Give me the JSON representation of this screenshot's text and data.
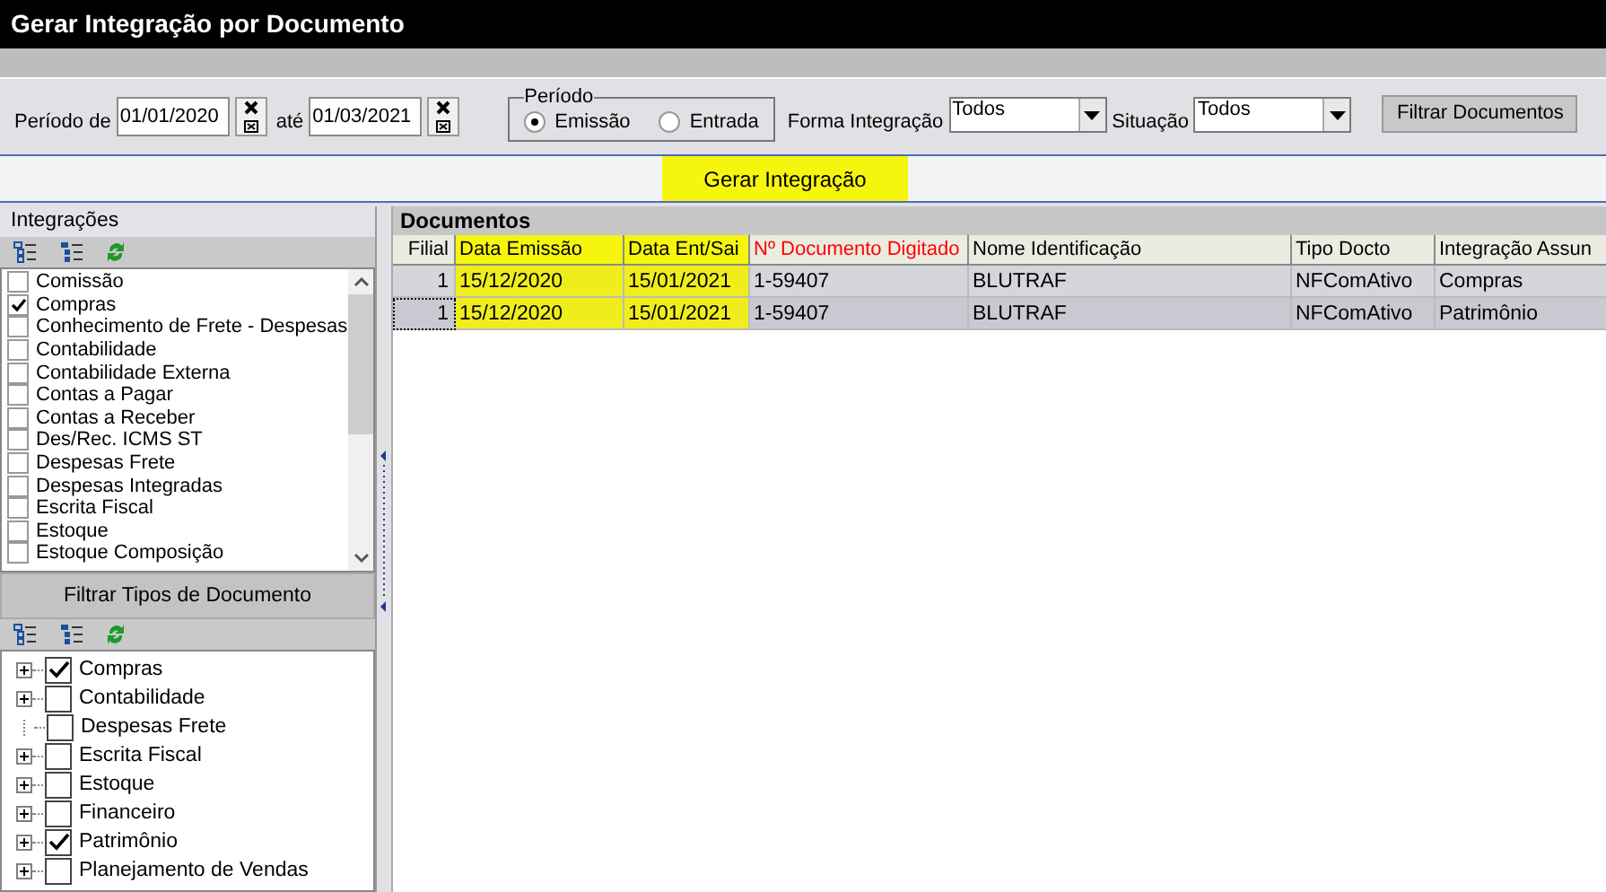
{
  "window": {
    "title": "Gerar Integração por Documento"
  },
  "filters": {
    "period_label": "Período de",
    "date_from": "01/01/2020",
    "until_label": "até",
    "date_to": "01/03/2021",
    "period_group": {
      "title": "Período",
      "options": [
        {
          "label": "Emissão",
          "selected": true
        },
        {
          "label": "Entrada",
          "selected": false
        }
      ]
    },
    "forma_label": "Forma Integração",
    "forma_value": "Todos",
    "situacao_label": "Situação",
    "situacao_value": "Todos",
    "filter_button": "Filtrar Documentos"
  },
  "generate_button": "Gerar Integração",
  "integrations": {
    "title": "Integrações",
    "items": [
      {
        "label": "Comissão",
        "checked": false
      },
      {
        "label": "Compras",
        "checked": true
      },
      {
        "label": "Conhecimento de Frete - Despesas",
        "checked": false
      },
      {
        "label": "Contabilidade",
        "checked": false
      },
      {
        "label": "Contabilidade Externa",
        "checked": false
      },
      {
        "label": "Contas a Pagar",
        "checked": false
      },
      {
        "label": "Contas a Receber",
        "checked": false
      },
      {
        "label": "Des/Rec. ICMS ST",
        "checked": false
      },
      {
        "label": "Despesas Frete",
        "checked": false
      },
      {
        "label": "Despesas Integradas",
        "checked": false
      },
      {
        "label": "Escrita Fiscal",
        "checked": false
      },
      {
        "label": "Estoque",
        "checked": false
      },
      {
        "label": "Estoque Composição",
        "checked": false
      }
    ]
  },
  "doc_types": {
    "title": "Filtrar Tipos de Documento",
    "items": [
      {
        "label": "Compras",
        "checked": true,
        "expandable": true
      },
      {
        "label": "Contabilidade",
        "checked": false,
        "expandable": true
      },
      {
        "label": "Despesas Frete",
        "checked": false,
        "expandable": false
      },
      {
        "label": "Escrita Fiscal",
        "checked": false,
        "expandable": true
      },
      {
        "label": "Estoque",
        "checked": false,
        "expandable": true
      },
      {
        "label": "Financeiro",
        "checked": false,
        "expandable": true
      },
      {
        "label": "Patrimônio",
        "checked": true,
        "expandable": true
      },
      {
        "label": "Planejamento de Vendas",
        "checked": false,
        "expandable": true
      }
    ]
  },
  "documents": {
    "title": "Documentos",
    "columns": [
      {
        "label": "Filial",
        "kind": "plain"
      },
      {
        "label": "Data Emissão",
        "kind": "highlighted"
      },
      {
        "label": "Data Ent/Sai",
        "kind": "highlighted"
      },
      {
        "label": "Nº Documento Digitado",
        "kind": "required"
      },
      {
        "label": "Nome Identificação",
        "kind": "plain"
      },
      {
        "label": "Tipo Docto",
        "kind": "plain"
      },
      {
        "label": "Integração Assun",
        "kind": "plain"
      }
    ],
    "rows": [
      {
        "selected": false,
        "cells": [
          "1",
          "15/12/2020",
          "15/01/2021",
          "1-59407",
          "BLUTRAF",
          "NFComAtivo",
          "Compras"
        ]
      },
      {
        "selected": true,
        "cells": [
          "1",
          "15/12/2020",
          "15/01/2021",
          "1-59407",
          "BLUTRAF",
          "NFComAtivo",
          "Patrimônio"
        ]
      }
    ]
  }
}
